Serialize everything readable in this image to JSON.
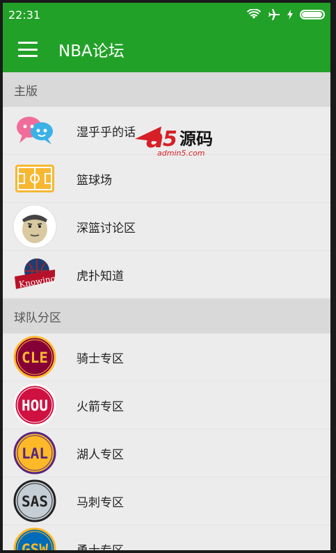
{
  "status_bar": {
    "time": "22:31",
    "battery_level": 0.95
  },
  "app_bar": {
    "title": "NBA论坛"
  },
  "sections": [
    {
      "title": "主版",
      "items": [
        {
          "label": "湿乎乎的话",
          "icon": "chat-bubbles-icon"
        },
        {
          "label": "篮球场",
          "icon": "basketball-court-icon"
        },
        {
          "label": "深篮讨论区",
          "icon": "face-avatar-icon"
        },
        {
          "label": "虎扑知道",
          "icon": "knowing-basketball-icon"
        }
      ]
    },
    {
      "title": "球队分区",
      "items": [
        {
          "label": "骑士专区",
          "icon": "cle-team-icon",
          "abbr": "CLE",
          "color": "#860038",
          "ring": "#fdbb30",
          "text_color": "#fdbb30"
        },
        {
          "label": "火箭专区",
          "icon": "hou-team-icon",
          "abbr": "HOU",
          "color": "#ce1141",
          "ring": "#ffffff",
          "text_color": "#ffffff"
        },
        {
          "label": "湖人专区",
          "icon": "lal-team-icon",
          "abbr": "LAL",
          "color": "#fdb927",
          "ring": "#552583",
          "text_color": "#552583"
        },
        {
          "label": "马刺专区",
          "icon": "sas-team-icon",
          "abbr": "SAS",
          "color": "#c4ced4",
          "ring": "#222222",
          "text_color": "#222222"
        },
        {
          "label": "勇士专区",
          "icon": "gsw-team-icon",
          "abbr": "GSW",
          "color": "#006bb6",
          "ring": "#fdb927",
          "text_color": "#fdb927"
        }
      ]
    }
  ],
  "watermark": {
    "brand": "a5源码",
    "site": "admin5.com"
  }
}
